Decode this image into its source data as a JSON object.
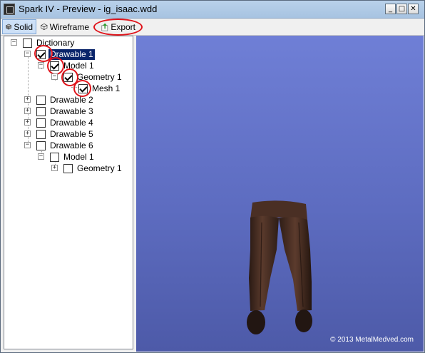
{
  "window": {
    "title": "Spark IV - Preview - ig_isaac.wdd",
    "minimize_icon": "minimize-icon",
    "maximize_icon": "maximize-icon",
    "close_icon": "close-icon"
  },
  "toolbar": {
    "solid_label": "Solid",
    "wireframe_label": "Wireframe",
    "export_label": "Export"
  },
  "tree": {
    "root": {
      "label": "Dictionary",
      "checked": false
    },
    "nodes": [
      {
        "label": "Drawable 1",
        "checked": true,
        "selected": true
      },
      {
        "label": "Model 1",
        "checked": true
      },
      {
        "label": "Geometry 1",
        "checked": true
      },
      {
        "label": "Mesh 1",
        "checked": true
      },
      {
        "label": "Drawable 2",
        "checked": false
      },
      {
        "label": "Drawable 3",
        "checked": false
      },
      {
        "label": "Drawable 4",
        "checked": false
      },
      {
        "label": "Drawable 5",
        "checked": false
      },
      {
        "label": "Drawable 6",
        "checked": false
      },
      {
        "label": "Model 1",
        "checked": false
      },
      {
        "label": "Geometry 1",
        "checked": false
      }
    ]
  },
  "viewport": {
    "copyright": "© 2013 MetalMedved.com",
    "background_color": "#6373c9",
    "model": "pants-3d-model"
  },
  "colors": {
    "annotation": "#e0141b",
    "selection": "#0a246a"
  }
}
